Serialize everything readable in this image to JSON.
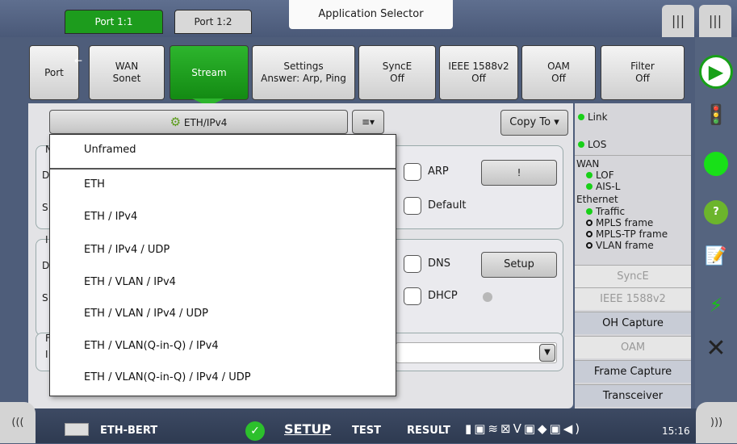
{
  "top": {
    "port_tabs": [
      "Port 1:1",
      "Port 1:2"
    ],
    "app_selector": "Application Selector",
    "right_tabs": [
      "|||",
      "|||"
    ]
  },
  "tabs": [
    {
      "l1": "Port",
      "l2": ""
    },
    {
      "l1": "WAN",
      "l2": "Sonet"
    },
    {
      "l1": "Stream",
      "l2": ""
    },
    {
      "l1": "Settings",
      "l2": "Answer: Arp, Ping"
    },
    {
      "l1": "SyncE",
      "l2": "Off"
    },
    {
      "l1": "IEEE 1588v2",
      "l2": "Off"
    },
    {
      "l1": "OAM",
      "l2": "Off"
    },
    {
      "l1": "Filter",
      "l2": "Off"
    }
  ],
  "main": {
    "frame_selector": "ETH/IPv4",
    "copy_to": "Copy To",
    "arp": "ARP",
    "arp_btn": "!",
    "default": "Default",
    "dns": "DNS",
    "setup": "Setup",
    "dhcp": "DHCP",
    "partial_letters": [
      "N",
      "D",
      "S",
      "I",
      "D",
      "S",
      "F",
      "I"
    ]
  },
  "dropdown": {
    "items": [
      "Unframed",
      "ETH",
      "ETH / IPv4",
      "ETH / IPv4 / UDP",
      "ETH / VLAN / IPv4",
      "ETH / VLAN / IPv4 / UDP",
      "ETH / VLAN(Q-in-Q) / IPv4",
      "ETH / VLAN(Q-in-Q) / IPv4 / UDP"
    ]
  },
  "status": {
    "link": "Link",
    "los": "LOS",
    "wan": "WAN",
    "lof": "LOF",
    "aisl": "AIS-L",
    "ethernet": "Ethernet",
    "traffic": "Traffic",
    "mpls": "MPLS frame",
    "mplstp": "MPLS-TP frame",
    "vlan": "VLAN frame",
    "buttons": [
      "SyncE",
      "IEEE 1588v2",
      "OH Capture",
      "OAM",
      "Frame Capture",
      "Transceiver"
    ]
  },
  "bottom": {
    "left": "(((",
    "app": "ETH-BERT",
    "setup": "SETUP",
    "test": "TEST",
    "result": "RESULT",
    "time": "15:16",
    "right": ")))"
  },
  "colors": {
    "accent_green": "#1d9c1d",
    "led_green": "#18d018"
  }
}
